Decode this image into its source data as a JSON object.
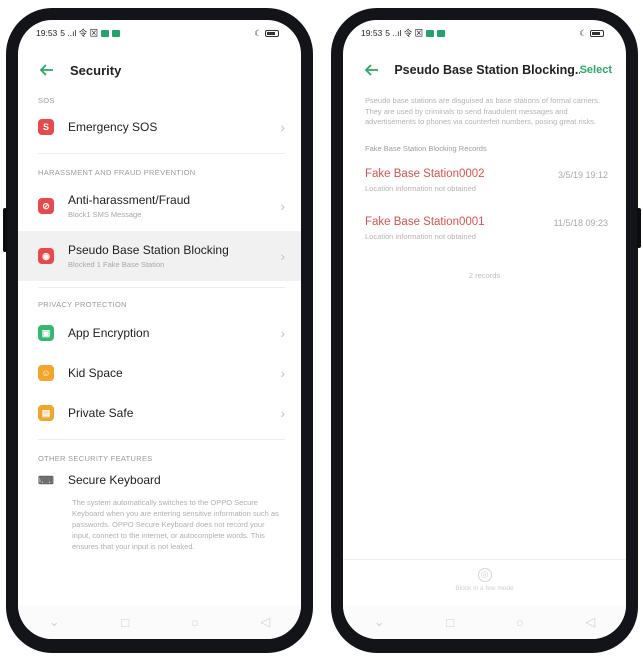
{
  "left": {
    "status": {
      "time": "19:53",
      "network": "5 ..ıl 令 ⊠"
    },
    "title": "Security",
    "sections": {
      "sos": {
        "label": "SOS"
      },
      "harassment": {
        "label": "HARASSMENT AND FRAUD PREVENTION"
      },
      "privacy": {
        "label": "PRIVACY PROTECTION"
      },
      "other": {
        "label": "OTHER SECURITY FEATURES"
      }
    },
    "items": {
      "emergency_sos": {
        "title": "Emergency SOS"
      },
      "anti_harassment": {
        "title": "Anti-harassment/Fraud",
        "subtitle": "Block1 SMS Message"
      },
      "pseudo_base": {
        "title": "Pseudo Base Station Blocking",
        "subtitle": "Blocked 1 Fake Base Station"
      },
      "app_encryption": {
        "title": "App Encryption"
      },
      "kid_space": {
        "title": "Kid Space"
      },
      "private_safe": {
        "title": "Private Safe"
      },
      "secure_keyboard": {
        "title": "Secure Keyboard",
        "description": "The system automatically switches to the OPPO Secure Keyboard when you are entering sensitive information such as passwords. OPPO Secure Keyboard does not record your input, connect to the internet, or autocomplete words. This ensures that your input is not leaked."
      }
    }
  },
  "right": {
    "status": {
      "time": "19:53",
      "network": "5 ..ıl 令 ⊠"
    },
    "title": "Pseudo Base Station Blocking...",
    "select_label": "Select",
    "description": "Pseudo base stations are disguised as base stations of formal carriers. They are used by criminals to send fraudulent messages and advertisements to phones via counterfeit numbers, posing great risks.",
    "records_label": "Fake Base Station Blocking Records",
    "records": [
      {
        "name": "Fake Base Station0002",
        "sub": "Location information not obtained",
        "time": "3/5/19 19:12"
      },
      {
        "name": "Fake Base Station0001",
        "sub": "Location information not obtained",
        "time": "11/5/18 09:23"
      }
    ],
    "count": "2 records",
    "bottom_action": "Block in a few mode"
  },
  "colors": {
    "accent_green": "#2aa865",
    "red": "#e64a4a",
    "green": "#35b96f",
    "orange": "#f3a52b",
    "record_red": "#d9534f"
  }
}
